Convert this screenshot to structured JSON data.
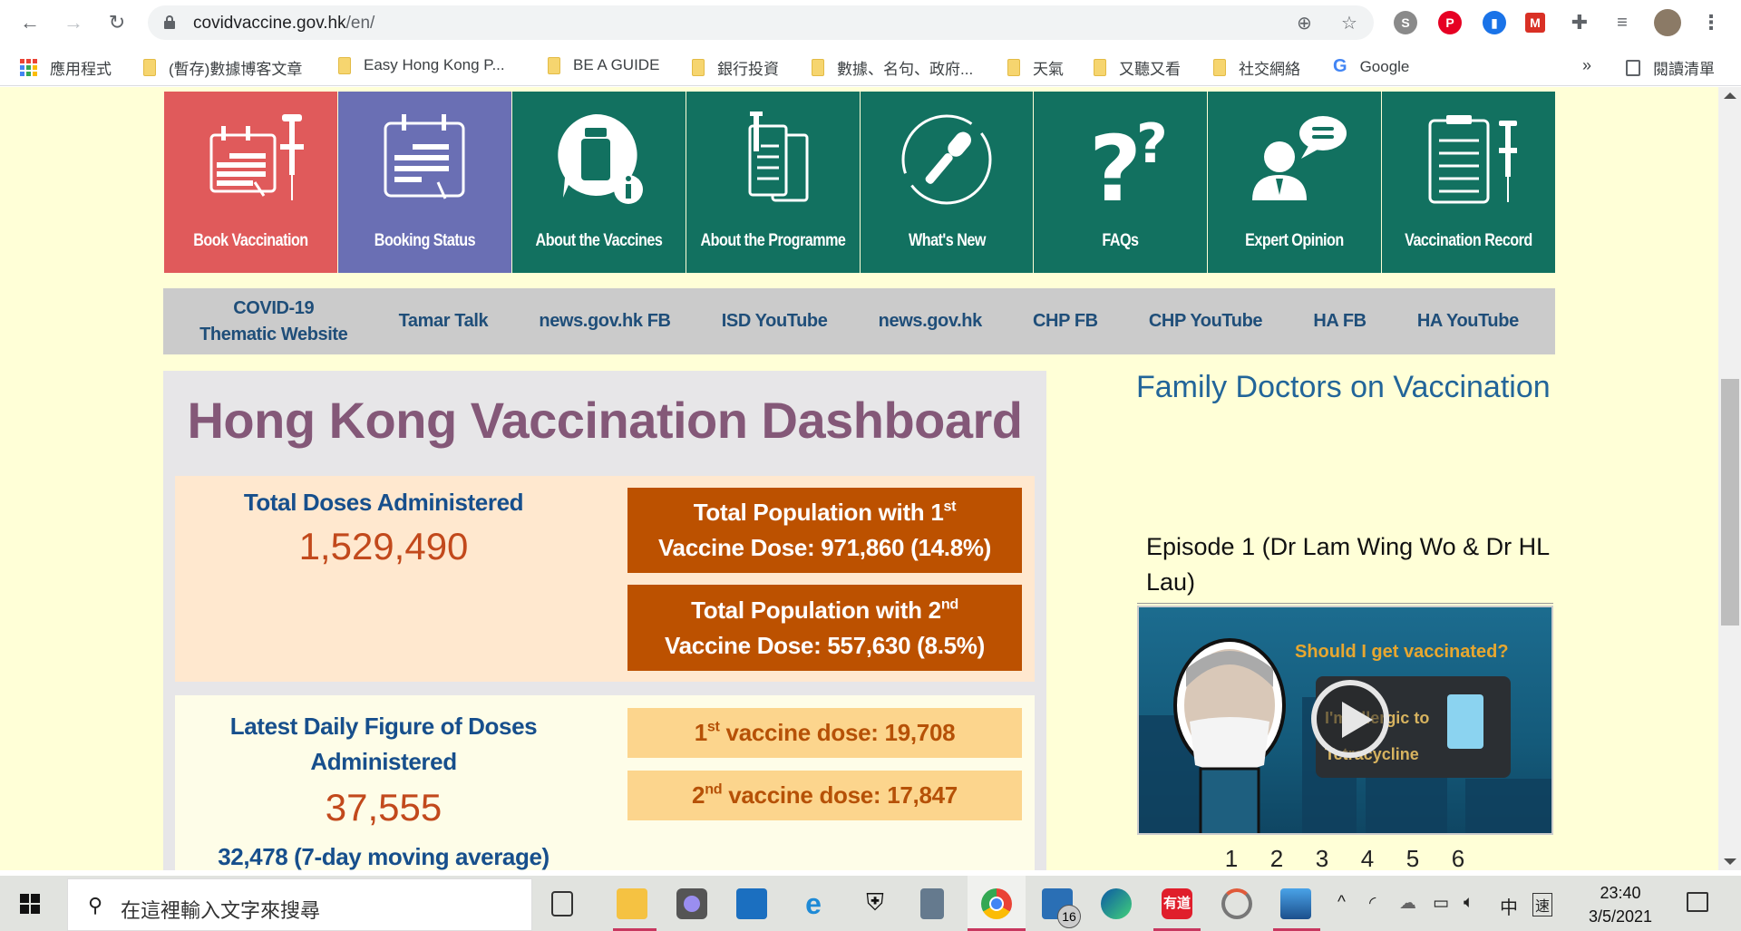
{
  "browser": {
    "url_host": "covidvaccine.gov.hk",
    "url_path": "/en/",
    "bookmarks": [
      {
        "label": "應用程式",
        "type": "apps"
      },
      {
        "label": "(暫存)數據博客文章",
        "type": "folder"
      },
      {
        "label": "Easy Hong Kong P...",
        "type": "folder"
      },
      {
        "label": "BE A GUIDE",
        "type": "folder"
      },
      {
        "label": "銀行投資",
        "type": "folder"
      },
      {
        "label": "數據、名句、政府...",
        "type": "folder"
      },
      {
        "label": "天氣",
        "type": "folder"
      },
      {
        "label": "又聽又看",
        "type": "folder"
      },
      {
        "label": "社交網絡",
        "type": "folder"
      },
      {
        "label": "Google",
        "type": "google"
      }
    ],
    "more_bookmarks": "»",
    "reading_list": "閱讀清單"
  },
  "tiles": [
    {
      "label": "Book Vaccination",
      "icon": "calendar-syringe-icon",
      "color": "#e05a5b"
    },
    {
      "label": "Booking Status",
      "icon": "calendar-status-icon",
      "color": "#6a6fb4"
    },
    {
      "label": "About the Vaccines",
      "icon": "vaccine-info-icon",
      "color": "#127160"
    },
    {
      "label": "About the Programme",
      "icon": "document-syringe-icon",
      "color": "#127160"
    },
    {
      "label": "What's New",
      "icon": "microphone-refresh-icon",
      "color": "#127160"
    },
    {
      "label": "FAQs",
      "icon": "question-marks-icon",
      "color": "#127160"
    },
    {
      "label": "Expert Opinion",
      "icon": "expert-speech-icon",
      "color": "#127160"
    },
    {
      "label": "Vaccination Record",
      "icon": "clipboard-syringe-icon",
      "color": "#127160"
    }
  ],
  "links": [
    {
      "line1": "COVID-19",
      "line2": "Thematic Website"
    },
    {
      "line1": "Tamar Talk"
    },
    {
      "line1": "news.gov.hk FB"
    },
    {
      "line1": "ISD YouTube"
    },
    {
      "line1": "news.gov.hk"
    },
    {
      "line1": "CHP FB"
    },
    {
      "line1": "CHP YouTube"
    },
    {
      "line1": "HA FB"
    },
    {
      "line1": "HA YouTube"
    }
  ],
  "dashboard": {
    "title": "Hong Kong Vaccination Dashboard",
    "total_label": "Total Doses Administered",
    "total_value": "1,529,490",
    "first_dose": {
      "pre": "Total Population with 1",
      "sup": "st",
      "line2": "Vaccine Dose: 971,860 (14.8%)"
    },
    "second_dose": {
      "pre": "Total Population with 2",
      "sup": "nd",
      "line2": "Vaccine Dose: 557,630 (8.5%)"
    },
    "daily_label_1": "Latest Daily Figure of Doses",
    "daily_label_2": "Administered",
    "daily_value": "37,555",
    "moving_avg": "32,478 (7-day moving average)",
    "daily_first": {
      "pre": "1",
      "sup": "st",
      "post": " vaccine dose: 19,708"
    },
    "daily_second": {
      "pre": "2",
      "sup": "nd",
      "post": " vaccine dose: 17,847"
    }
  },
  "family_doctors": {
    "title": "Family Doctors on Vaccination",
    "episode_title": "Episode 1 (Dr Lam Wing Wo & Dr HL Lau)",
    "video_caption": "Should I get vaccinated?",
    "video_bubble_1": "I'm allergic to",
    "video_bubble_2": "Tetracycline",
    "pages": [
      "1",
      "2",
      "3",
      "4",
      "5",
      "6"
    ]
  },
  "taskbar": {
    "search_placeholder": "在這裡輸入文字來搜尋",
    "mail_badge": "16",
    "youdao_label": "有道",
    "ime_lang": "中",
    "ime_mode": "速",
    "time": "23:40",
    "date": "3/5/2021"
  }
}
